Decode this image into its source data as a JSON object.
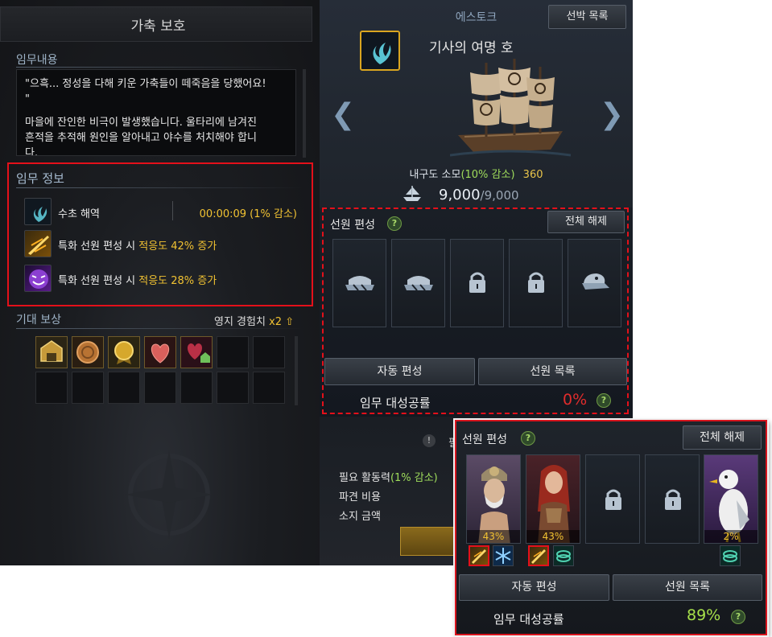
{
  "left": {
    "title": "가축 보호",
    "mission_label": "임무내용",
    "mission_lines": [
      "\"으흑... 정성을 다해 키운 가축들이 떼죽음을 당했어요!",
      "\"",
      "마을에 잔인한 비극이 발생했습니다. 울타리에 남겨진",
      "흔적을 추적해 원인을 알아내고 야수를 처치해야 합니",
      "다."
    ],
    "info_label": "임무 정보",
    "info": {
      "sea_name": "수초 해역",
      "sea_time": "00:00:09 (1% 감소)",
      "bonus1_prefix": "특화 선원 편성 시 ",
      "bonus1_value": "적응도 42% 증가",
      "bonus2_prefix": "특화 선원 편성 시 ",
      "bonus2_value": "적응도 28% 증가"
    },
    "reward_label": "기대 보상",
    "reward_exp": "영지 경험치",
    "reward_mult": "x2",
    "reward_items": [
      "estate-crest-icon",
      "bronze-coin-icon",
      "gold-medal-icon",
      "heart-item-icon",
      "heart-house-icon"
    ]
  },
  "right": {
    "ship_type": "에스토크",
    "ship_list_button": "선박 목록",
    "ship_name": "기사의 여명 호",
    "durability_label": "내구도 소모",
    "durability_reduction": "(10% 감소)",
    "durability_value": "360",
    "capacity_current": "9,000",
    "capacity_max": "/9,000",
    "crew_label": "선원 편성",
    "clear_all_button": "전체 해제",
    "auto_button": "자동 편성",
    "crew_list_button": "선원 목록",
    "rate_label": "임무 대성공률",
    "rate_value": "0%",
    "dispatch_hint": "필",
    "required_action": "필요 활동력",
    "required_action_reduction": "(1% 감소)",
    "dispatch_cost": "파견 비용",
    "owned_gold": "소지 금액"
  },
  "overlay": {
    "crew_label": "선원 편성",
    "clear_all_button": "전체 해제",
    "crew": [
      {
        "name": "old-sailor",
        "pct": "43%"
      },
      {
        "name": "red-hair-woman",
        "pct": "43%"
      },
      {
        "name": "locked",
        "pct": ""
      },
      {
        "name": "locked",
        "pct": ""
      },
      {
        "name": "seagull",
        "pct": "2%"
      }
    ],
    "auto_button": "자동 편성",
    "crew_list_button": "선원 목록",
    "rate_label": "임무 대성공률",
    "rate_value": "89%"
  },
  "colors": {
    "highlight_red": "#e4101a",
    "gold_text": "#f1c232",
    "green_text": "#9fdc5b",
    "rate_red": "#e12c2c"
  }
}
